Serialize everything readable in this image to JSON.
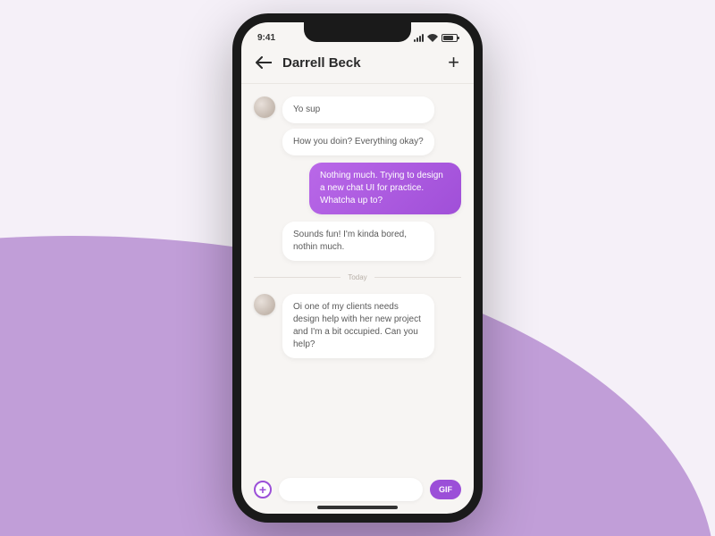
{
  "status": {
    "time": "9:41"
  },
  "header": {
    "contact_name": "Darrell Beck"
  },
  "messages": {
    "m0": "Yo sup",
    "m1": "How you doin? Everything okay?",
    "m2": "Nothing much. Trying to design a new chat UI for practice. Whatcha up to?",
    "m3": "Sounds fun! I'm kinda bored, nothin much.",
    "m4": "Oi one of my clients needs design help with her new project and I'm a bit occupied. Can you help?"
  },
  "divider": {
    "label": "Today"
  },
  "input": {
    "gif_label": "GIF",
    "placeholder": ""
  },
  "colors": {
    "accent": "#9b4fd8",
    "bubble_gradient_start": "#b968e8",
    "bubble_gradient_end": "#a04fd8",
    "bg_wave": "#c19ed8"
  }
}
